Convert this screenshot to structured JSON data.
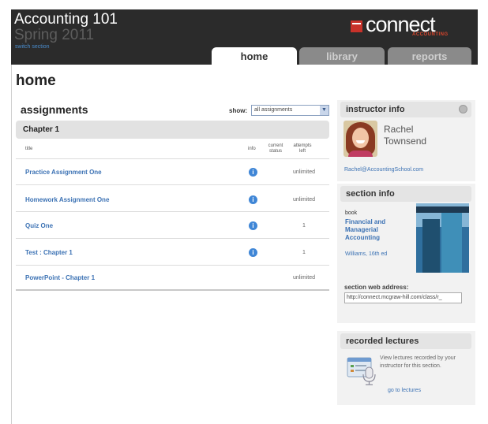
{
  "header": {
    "course_title": "Accounting 101",
    "term": "Spring 2011",
    "switch_section": "switch section",
    "logo_text": "connect",
    "logo_sub": "ACCOUNTING"
  },
  "tabs": [
    {
      "label": "home",
      "active": true
    },
    {
      "label": "library",
      "active": false
    },
    {
      "label": "reports",
      "active": false
    }
  ],
  "page_title": "home",
  "assignments": {
    "title": "assignments",
    "show_label": "show:",
    "show_value": "all assignments",
    "chapter": "Chapter 1",
    "columns": {
      "title": "title",
      "info": "info",
      "status": "current status",
      "attempts": "attempts left"
    },
    "rows": [
      {
        "title": "Practice Assignment One",
        "has_info": true,
        "attempts": "unlimited"
      },
      {
        "title": "Homework Assignment One",
        "has_info": true,
        "attempts": "unlimited"
      },
      {
        "title": "Quiz One",
        "has_info": true,
        "attempts": "1"
      },
      {
        "title": "Test : Chapter 1",
        "has_info": true,
        "attempts": "1"
      },
      {
        "title": "PowerPoint - Chapter 1",
        "has_info": false,
        "attempts": "unlimited"
      }
    ]
  },
  "instructor": {
    "heading": "instructor info",
    "name": "Rachel Townsend",
    "email": "Rachel@AccountingSchool.com"
  },
  "section": {
    "heading": "section info",
    "book_label": "book",
    "book_title": "Financial and Managerial Accounting",
    "book_author": "Williams, 16th ed",
    "address_label": "section web address:",
    "address_value": "http://connect.mcgraw-hill.com/class/r_"
  },
  "lectures": {
    "heading": "recorded lectures",
    "text": "View lectures recorded by your instructor for this section.",
    "link": "go to lectures"
  },
  "colors": {
    "header_bg": "#2b2b2b",
    "link": "#3c72b4",
    "brand_red": "#c8322a",
    "info_blue": "#3f86d6"
  },
  "icons": [
    "gear-icon",
    "info-icon",
    "microphone-icon",
    "chevron-down-icon"
  ]
}
